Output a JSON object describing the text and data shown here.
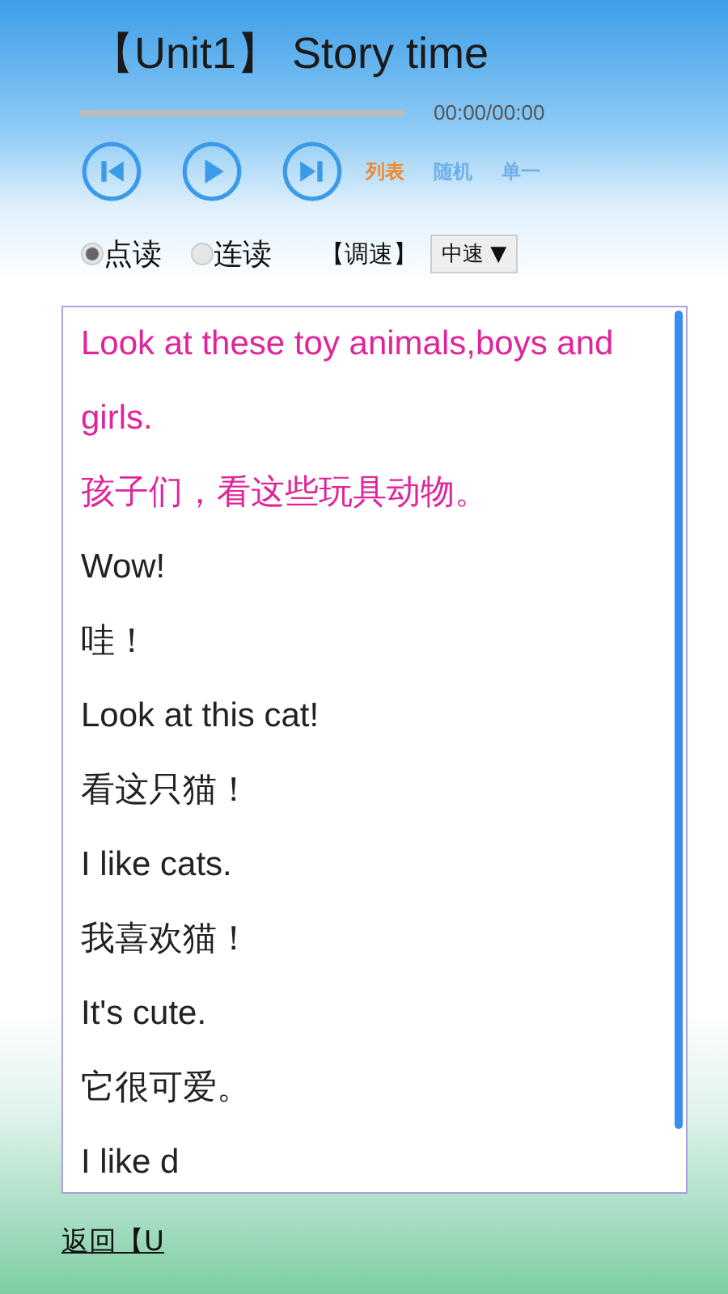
{
  "title": "【Unit1】 Story time",
  "player": {
    "time": "00:00/00:00"
  },
  "controls": [
    {
      "kind": "previous"
    },
    {
      "kind": "play"
    },
    {
      "kind": "next"
    }
  ],
  "play_modes": [
    {
      "label": "列表",
      "selected": true
    },
    {
      "label": "随机",
      "selected": false
    },
    {
      "label": "单一",
      "selected": false
    }
  ],
  "read_modes": [
    {
      "label": "点读",
      "selected": true
    },
    {
      "label": "连读",
      "selected": false
    }
  ],
  "speed": {
    "label": "【调速】",
    "value": "中速",
    "arrow": "▼"
  },
  "sentences": [
    {
      "en": "Look at these toy animals,boys and girls.",
      "zh": "孩子们，看这些玩具动物。",
      "selected": true
    },
    {
      "en": "Wow!",
      "zh": "哇！",
      "selected": false
    },
    {
      "en": "Look at this cat!",
      "zh": "看这只猫！",
      "selected": false
    },
    {
      "en": "I like cats.",
      "zh": "我喜欢猫！",
      "selected": false
    },
    {
      "en": "It's cute.",
      "zh": "它很可爱。",
      "selected": false
    },
    {
      "en": "I like d",
      "selected": false
    }
  ],
  "back_link": "返回【U"
}
